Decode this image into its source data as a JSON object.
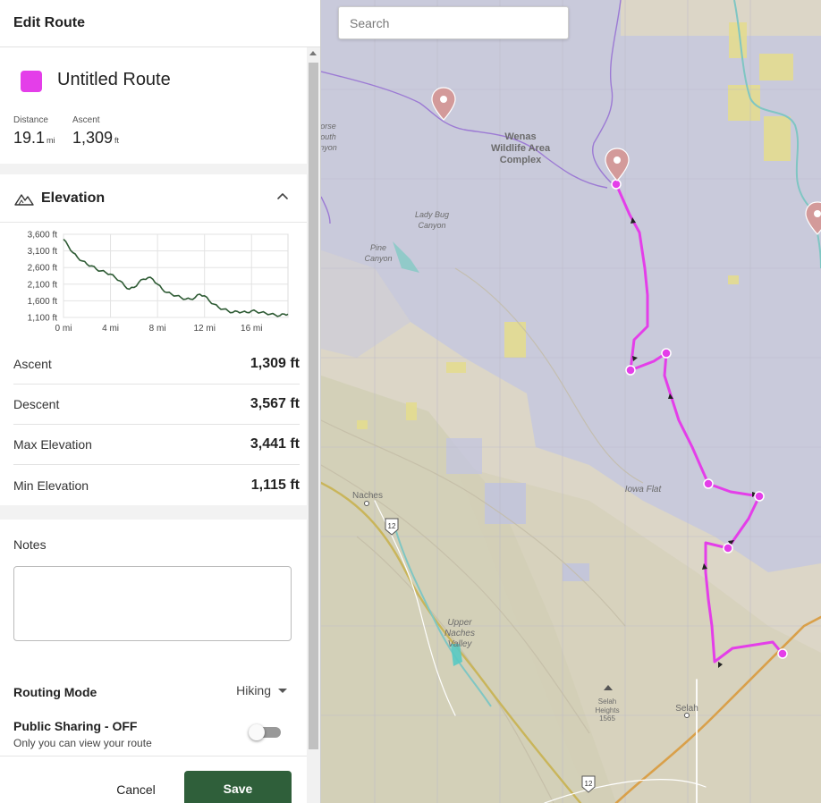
{
  "sidebar": {
    "title": "Edit Route",
    "route": {
      "name": "Untitled Route",
      "color": "#e43ee9",
      "distance_label": "Distance",
      "distance_value": "19.1",
      "distance_unit": "mi",
      "ascent_label": "Ascent",
      "ascent_value": "1,309",
      "ascent_unit": "ft"
    },
    "elevation": {
      "title": "Elevation",
      "icon": "mountain-icon",
      "toggle_icon": "chevron-up-icon",
      "stats": [
        {
          "label": "Ascent",
          "value": "1,309 ft"
        },
        {
          "label": "Descent",
          "value": "3,567 ft"
        },
        {
          "label": "Max Elevation",
          "value": "3,441 ft"
        },
        {
          "label": "Min Elevation",
          "value": "1,115 ft"
        }
      ]
    },
    "notes": {
      "label": "Notes",
      "value": "",
      "placeholder": ""
    },
    "routing": {
      "label": "Routing Mode",
      "value": "Hiking"
    },
    "sharing": {
      "label": "Public Sharing - OFF",
      "sub": "Only you can view your route",
      "enabled": false
    },
    "actions": {
      "cancel": "Cancel",
      "save": "Save",
      "save_color": "#2f5f3a"
    }
  },
  "chart_data": {
    "type": "line",
    "title": "",
    "xlabel": "",
    "ylabel": "",
    "x_ticks": [
      "0 mi",
      "4 mi",
      "8 mi",
      "12 mi",
      "16 mi"
    ],
    "y_ticks": [
      "3,600 ft",
      "3,100 ft",
      "2,600 ft",
      "2,100 ft",
      "1,600 ft",
      "1,100 ft"
    ],
    "xlim": [
      0,
      19.1
    ],
    "ylim": [
      1100,
      3600
    ],
    "grid": true,
    "line_color": "#2e5b34",
    "series": [
      {
        "x": [
          0,
          0.4,
          0.8,
          1.2,
          1.6,
          2.0,
          2.4,
          2.8,
          3.2,
          3.6,
          4.0,
          4.4,
          4.8,
          5.2,
          5.6,
          6.0,
          6.4,
          6.8,
          7.2,
          7.6,
          8.0,
          8.4,
          8.8,
          9.2,
          9.6,
          10.0,
          10.4,
          10.8,
          11.2,
          11.6,
          12.0,
          12.4,
          12.8,
          13.2,
          13.6,
          14.0,
          14.4,
          14.8,
          15.2,
          15.6,
          16.0,
          16.4,
          16.8,
          17.2,
          17.6,
          18.0,
          18.4,
          18.8,
          19.1
        ],
        "y": [
          3450,
          3250,
          3050,
          2900,
          2800,
          2700,
          2650,
          2550,
          2500,
          2450,
          2400,
          2300,
          2200,
          2050,
          1950,
          2000,
          2150,
          2250,
          2300,
          2250,
          2100,
          1950,
          1850,
          1800,
          1750,
          1700,
          1650,
          1650,
          1700,
          1800,
          1750,
          1600,
          1500,
          1400,
          1350,
          1300,
          1250,
          1280,
          1260,
          1250,
          1300,
          1280,
          1250,
          1230,
          1200,
          1180,
          1150,
          1200,
          1200
        ]
      }
    ]
  },
  "map": {
    "search_placeholder": "Search",
    "labels": {
      "wenas": "Wenas",
      "wildlife": "Wildlife Area",
      "complex": "Complex",
      "ladybug1": "Lady Bug",
      "ladybug2": "Canyon",
      "pine1": "Pine",
      "pine2": "Canyon",
      "horse1": "orse",
      "horse2": "outh",
      "horse3": "nyon",
      "iowa": "Iowa Flat",
      "naches": "Naches",
      "upper1": "Upper",
      "upper2": "Naches",
      "upper3": "Valley",
      "selahh1": "Selah",
      "selahh2": "Heights",
      "selahh3": "1565",
      "selah": "Selah",
      "hwy12a": "12",
      "hwy12b": "12"
    },
    "route_color": "#e43ee9",
    "marker_icon": "map-pin-icon"
  }
}
